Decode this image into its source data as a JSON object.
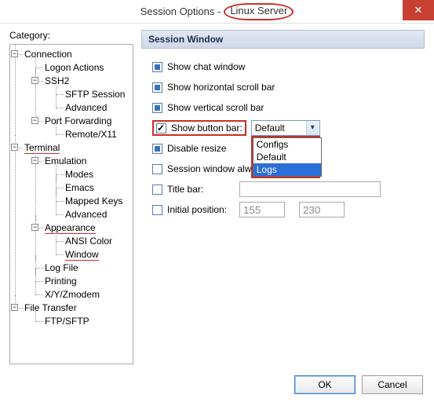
{
  "title_prefix": "Session Options -",
  "title_session": "Linux Server",
  "close_glyph": "✕",
  "category_label": "Category:",
  "tree": {
    "connection": "Connection",
    "logon_actions": "Logon Actions",
    "ssh2": "SSH2",
    "sftp_session": "SFTP Session",
    "advanced_ssh": "Advanced",
    "port_fwd": "Port Forwarding",
    "remote_x11": "Remote/X11",
    "terminal": "Terminal",
    "emulation": "Emulation",
    "modes": "Modes",
    "emacs": "Emacs",
    "mapped_keys": "Mapped Keys",
    "advanced_emul": "Advanced",
    "appearance": "Appearance",
    "ansi_color": "ANSI Color",
    "window": "Window",
    "log_file": "Log File",
    "printing": "Printing",
    "xyz": "X/Y/Zmodem",
    "file_transfer": "File Transfer",
    "ftp_sftp": "FTP/SFTP"
  },
  "section_header": "Session Window",
  "opts": {
    "show_chat": "Show chat window",
    "show_hscroll": "Show horizontal scroll bar",
    "show_vscroll": "Show vertical scroll bar",
    "show_button_bar": "Show button bar:",
    "disable_resize": "Disable resize",
    "session_always": "Session window alwa",
    "title_bar": "Title bar:",
    "initial_pos": "Initial position:"
  },
  "select": {
    "value": "Default",
    "opt_configs": "Configs",
    "opt_default": "Default",
    "opt_logs": "Logs"
  },
  "pos_x": "155",
  "pos_y": "230",
  "buttons": {
    "ok": "OK",
    "cancel": "Cancel"
  }
}
